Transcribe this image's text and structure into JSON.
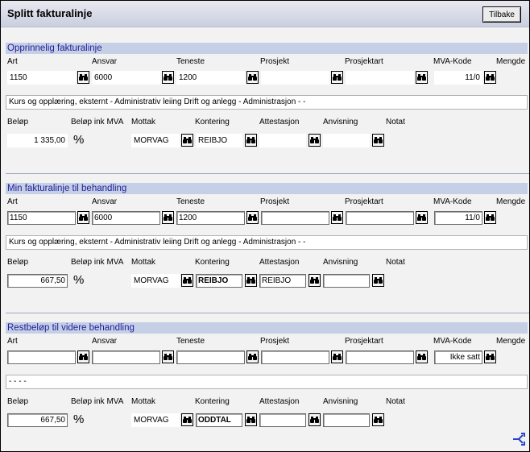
{
  "header": {
    "title": "Splitt fakturalinje",
    "back_label": "Tilbake"
  },
  "columns": {
    "art": "Art",
    "ansvar": "Ansvar",
    "teneste": "Teneste",
    "prosjekt": "Prosjekt",
    "prosjektart": "Prosjektart",
    "mva": "MVA-Kode",
    "mengde": "Mengde",
    "belop": "Beløp",
    "belop_mva": "Beløp ink MVA",
    "mottak": "Mottak",
    "kontering": "Kontering",
    "attestasjon": "Attestasjon",
    "anvisning": "Anvisning",
    "notat": "Notat"
  },
  "icons": {
    "lookup": "binoculars-icon",
    "percent": "percent-icon",
    "corner": "split-arrow-icon"
  },
  "colors": {
    "section_header_bg": "#c5cfe6",
    "section_header_text": "#1f1f99"
  },
  "sections": [
    {
      "title": "Opprinnelig fakturalinje",
      "art": "1150",
      "ansvar": "6000",
      "teneste": "1200",
      "prosjekt": "",
      "prosjektart": "",
      "mva": "11/0",
      "description": "Kurs og opplæring, eksternt - Administrativ leiing Drift og anlegg - Administrasjon - -",
      "belop": "1 335,00",
      "pct": "%",
      "mottak": "MORVAG",
      "kontering": "REIBJO",
      "attestasjon": "",
      "anvisning": ""
    },
    {
      "title": "Min fakturalinje til behandling",
      "art": "1150",
      "ansvar": "6000",
      "teneste": "1200",
      "prosjekt": "",
      "prosjektart": "",
      "mva": "11/0",
      "description": "Kurs og opplæring, eksternt - Administrativ leiing Drift og anlegg - Administrasjon - -",
      "belop": "667,50",
      "pct": "%",
      "mottak": "MORVAG",
      "kontering": "REIBJO",
      "attestasjon": "REIBJO",
      "anvisning": ""
    },
    {
      "title": "Restbeløp til videre behandling",
      "art": "",
      "ansvar": "",
      "teneste": "",
      "prosjekt": "",
      "prosjektart": "",
      "mva": "Ikke satt",
      "description": "- - - -",
      "belop": "667,50",
      "pct": "%",
      "mottak": "MORVAG",
      "kontering": "ODDTAL",
      "attestasjon": "",
      "anvisning": ""
    }
  ]
}
